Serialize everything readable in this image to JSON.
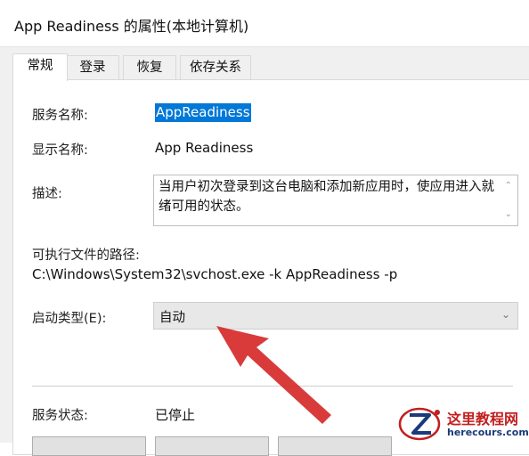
{
  "window": {
    "title": "App Readiness 的属性(本地计算机)"
  },
  "tabs": [
    {
      "label": "常规"
    },
    {
      "label": "登录"
    },
    {
      "label": "恢复"
    },
    {
      "label": "依存关系"
    }
  ],
  "general": {
    "service_name_label": "服务名称:",
    "service_name_value": "AppReadiness",
    "display_name_label": "显示名称:",
    "display_name_value": "App Readiness",
    "description_label": "描述:",
    "description_value": "当用户初次登录到这台电脑和添加新应用时，使应用进入就绪可用的状态。",
    "exe_path_label": "可执行文件的路径:",
    "exe_path_value": "C:\\Windows\\System32\\svchost.exe -k AppReadiness -p",
    "startup_type_label": "启动类型(E):",
    "startup_type_value": "自动",
    "service_status_label": "服务状态:",
    "service_status_value": "已停止"
  },
  "icons": {
    "scroll_up": "chevron-up-icon",
    "scroll_down": "chevron-down-icon",
    "combo": "chevron-down-icon"
  },
  "colors": {
    "selection": "#0078d7",
    "annotation_arrow": "#d62a2a",
    "watermark_red": "#c21f1f",
    "watermark_blue": "#1a3a7a"
  },
  "watermark": {
    "name": "这里教程网",
    "url": "herecours.com"
  }
}
